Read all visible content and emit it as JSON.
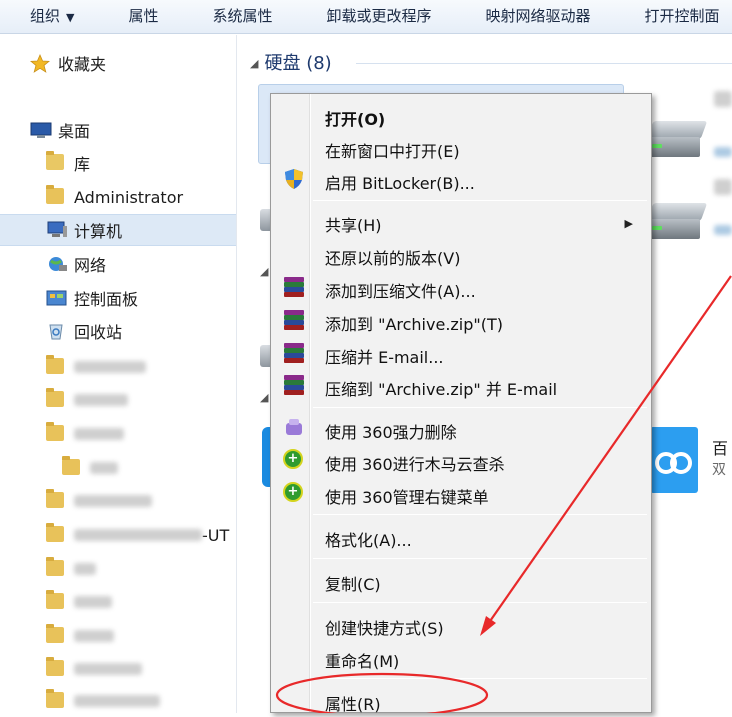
{
  "toolbar": {
    "items": [
      "组织",
      "属性",
      "系统属性",
      "卸载或更改程序",
      "映射网络驱动器",
      "打开控制面"
    ]
  },
  "nav": {
    "favorites": "收藏夹",
    "desktop": "桌面",
    "library": "库",
    "admin": "Administrator",
    "computer": "计算机",
    "network": "网络",
    "control_panel": "控制面板",
    "recycle_bin": "回收站",
    "partial_suffix": "-UT"
  },
  "content": {
    "group_disk": "硬盘 (8)",
    "tile_letter_2": "百",
    "tile_letter_2b": "双"
  },
  "menu": {
    "open": "打开(O)",
    "open_new_window": "在新窗口中打开(E)",
    "bitlocker": "启用 BitLocker(B)...",
    "share": "共享(H)",
    "restore": "还原以前的版本(V)",
    "add_archive": "添加到压缩文件(A)...",
    "add_zip": "添加到 \"Archive.zip\"(T)",
    "compress_email": "压缩并 E-mail...",
    "compress_zip_email": "压缩到 \"Archive.zip\" 并 E-mail",
    "del_360": "使用 360强力删除",
    "scan_360": "使用 360进行木马云查杀",
    "menu_360": "使用 360管理右键菜单",
    "format": "格式化(A)...",
    "copy": "复制(C)",
    "shortcut": "创建快捷方式(S)",
    "rename": "重命名(M)",
    "properties": "属性(R)"
  },
  "colors": {
    "annotation": "#e8292a",
    "selection": "#dde9f6"
  }
}
